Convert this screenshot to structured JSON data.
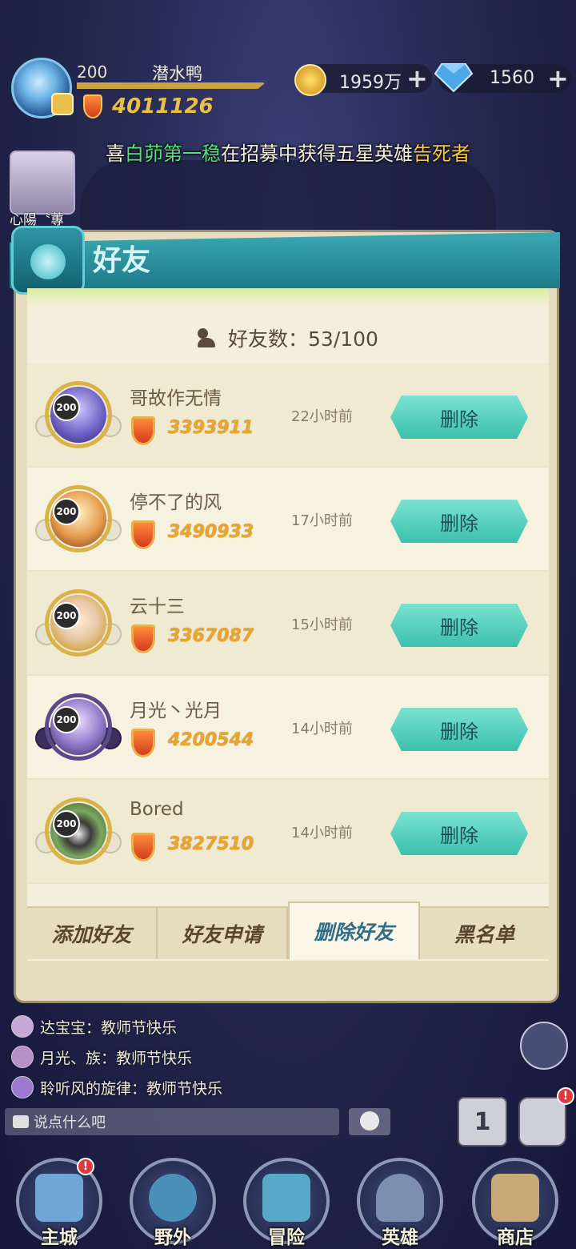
{
  "player": {
    "level": "200",
    "name": "潜水鸭",
    "power": "4011126"
  },
  "resources": {
    "gold": "1959万",
    "diamonds": "1560"
  },
  "ticker": {
    "prefix": "喜",
    "player": "白茆第一稳",
    "middle": "在招募中获得五星英雄",
    "hero": "告死者"
  },
  "side_label": "心陽〝蓴",
  "panel": {
    "title": "好友",
    "friend_count_label": "好友数：53/100"
  },
  "friends": [
    {
      "level": "200",
      "name": "哥故作无情",
      "power": "3393911",
      "last_seen": "22小时前",
      "action": "删除",
      "face": "#6a5cc2"
    },
    {
      "level": "200",
      "name": "停不了的风",
      "power": "3490933",
      "last_seen": "17小时前",
      "action": "删除",
      "face": "#e59a4a"
    },
    {
      "level": "200",
      "name": "云十三",
      "power": "3367087",
      "last_seen": "15小时前",
      "action": "删除",
      "face": "#e8c9a8"
    },
    {
      "level": "200",
      "name": "月光丶光月",
      "power": "4200544",
      "last_seen": "14小时前",
      "action": "删除",
      "face": "#8d78c8"
    },
    {
      "level": "200",
      "name": "Bored",
      "power": "3827510",
      "last_seen": "14小时前",
      "action": "删除",
      "face": "#7aa860"
    }
  ],
  "tabs": [
    "添加好友",
    "好友申请",
    "删除好友",
    "黑名单"
  ],
  "active_tab": "删除好友",
  "chat": [
    {
      "text": "达宝宝：教师节快乐"
    },
    {
      "text": "月光、族：教师节快乐"
    },
    {
      "text": "聆听风的旋律：教师节快乐"
    }
  ],
  "chat_placeholder": "说点什么吧",
  "rank_label": "1",
  "notification_mark": "!",
  "nav": [
    {
      "label": "主城",
      "color": "#6fa6d8"
    },
    {
      "label": "野外",
      "color": "#4a8fb8"
    },
    {
      "label": "冒险",
      "color": "#5aa8c8"
    },
    {
      "label": "英雄",
      "color": "#7d8fb0"
    },
    {
      "label": "商店",
      "color": "#c8a878"
    }
  ],
  "colors": {
    "accent_teal": "#3cc0ad",
    "power_gold": "#e9a62a",
    "ticker_green": "#58e07a",
    "ticker_gold": "#f5c94a"
  }
}
